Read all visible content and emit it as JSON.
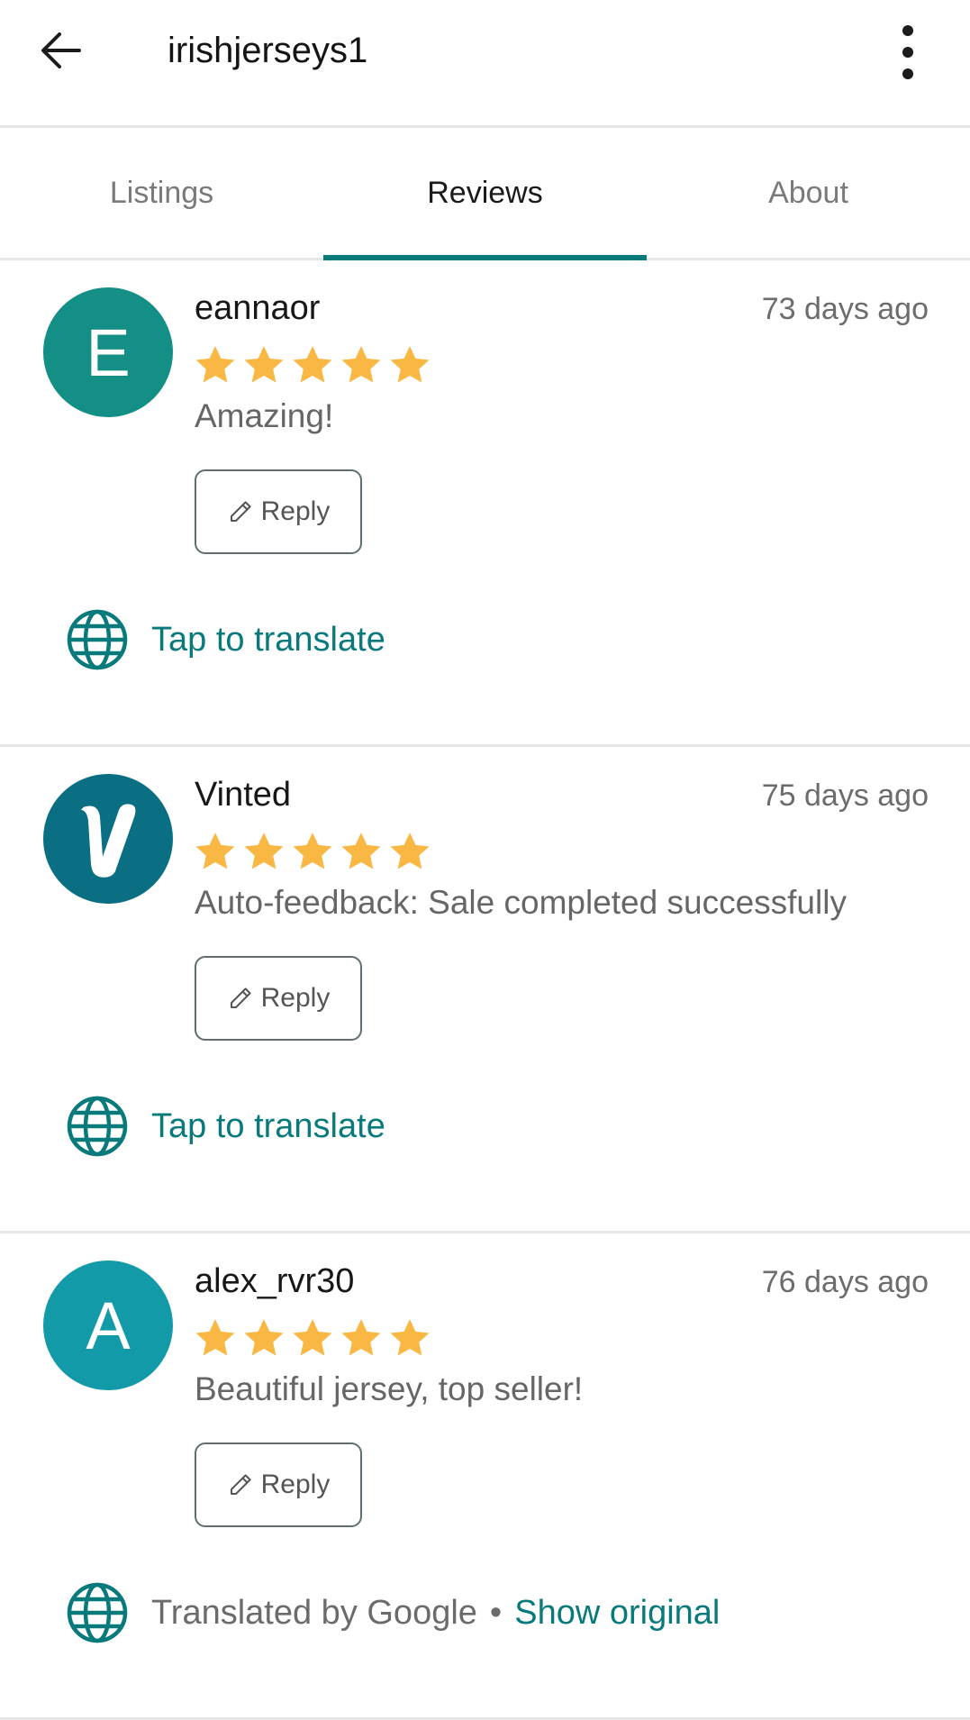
{
  "header": {
    "title": "irishjerseys1",
    "back_icon": "arrow-left-icon",
    "menu_icon": "more-vertical-icon"
  },
  "tabs": [
    {
      "label": "Listings",
      "active": false
    },
    {
      "label": "Reviews",
      "active": true
    },
    {
      "label": "About",
      "active": false
    }
  ],
  "colors": {
    "accent": "#097a7c",
    "star": "#f9b843",
    "avatar_e": "#148f85",
    "avatar_v": "#0a6f82",
    "avatar_a": "#139aa8"
  },
  "reviews": [
    {
      "username": "eannaor",
      "avatar_letter": "E",
      "time": "73 days ago",
      "rating": 5,
      "comment": "Amazing!",
      "reply_label": "Reply",
      "translate_text": "Tap to translate"
    },
    {
      "username": "Vinted",
      "avatar_letter": "V",
      "time": "75 days ago",
      "rating": 5,
      "comment": "Auto-feedback: Sale completed successfully",
      "reply_label": "Reply",
      "translate_text": "Tap to translate"
    },
    {
      "username": "alex_rvr30",
      "avatar_letter": "A",
      "time": "76 days ago",
      "rating": 5,
      "comment": "Beautiful jersey, top seller!",
      "reply_label": "Reply",
      "translated_by": "Translated by Google",
      "separator": "•",
      "show_original": "Show original"
    }
  ]
}
